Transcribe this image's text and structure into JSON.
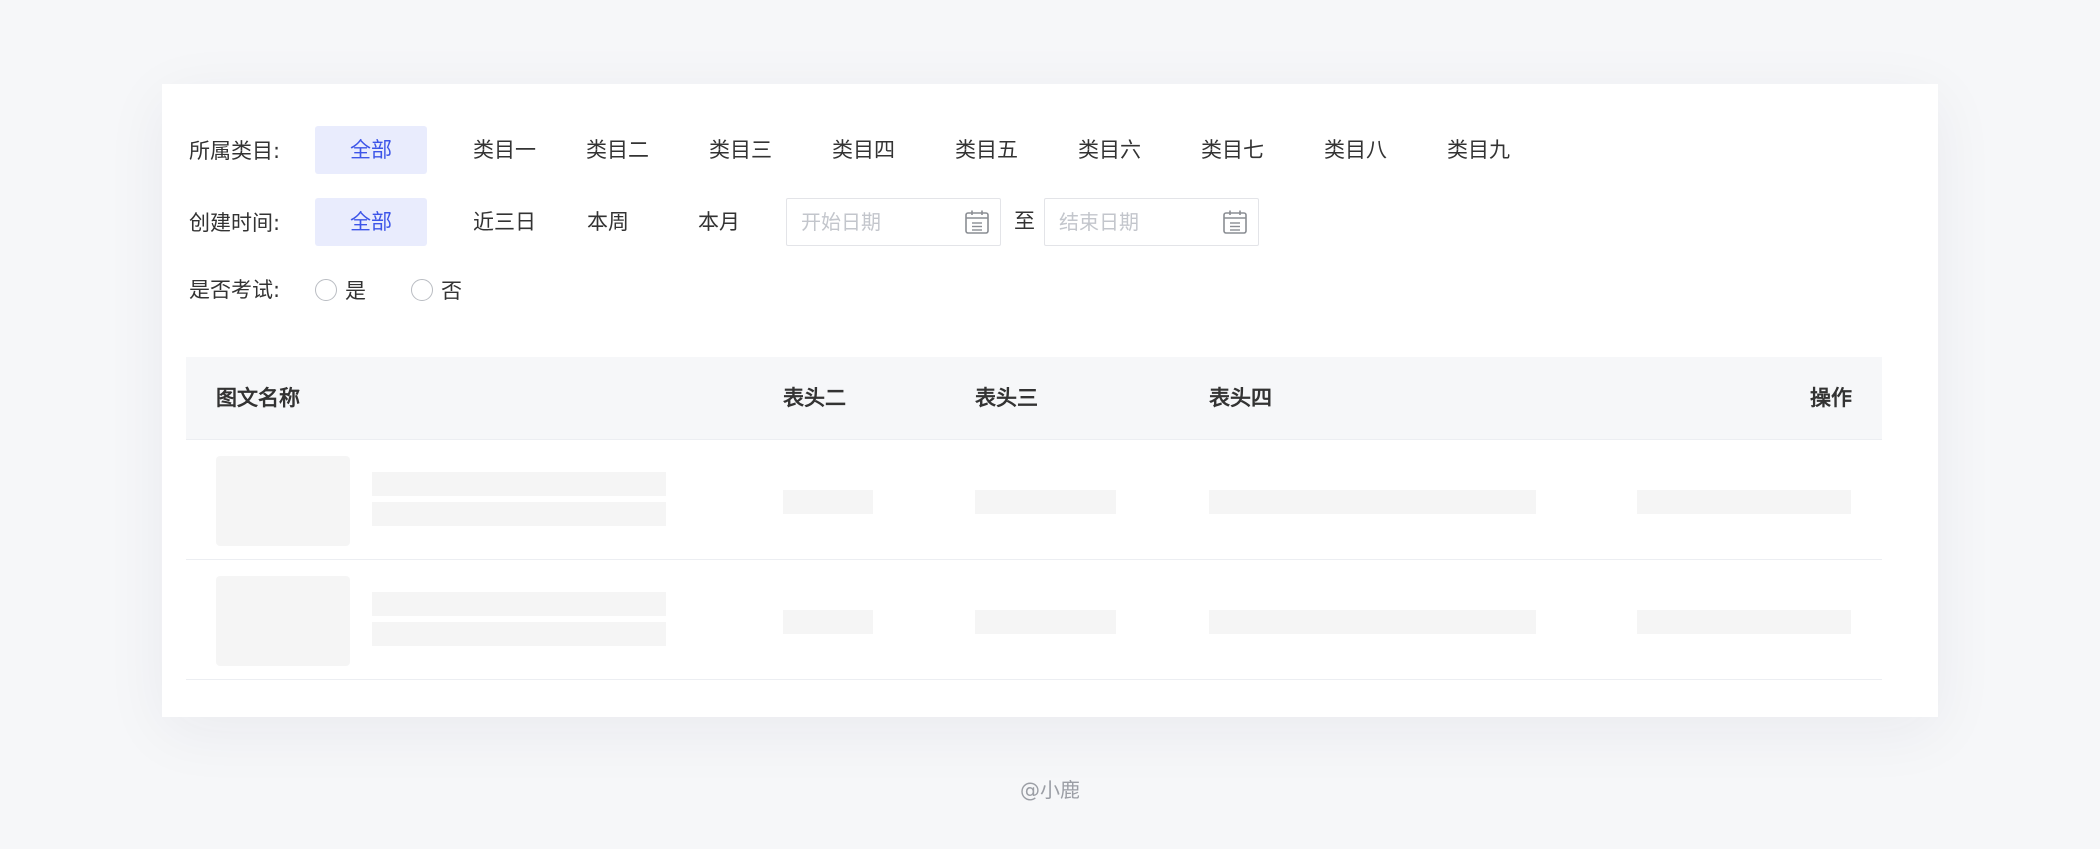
{
  "filters": {
    "category": {
      "label": "所属类目:",
      "options": [
        "全部",
        "类目一",
        "类目二",
        "类目三",
        "类目四",
        "类目五",
        "类目六",
        "类目七",
        "类目八",
        "类目九"
      ],
      "selected": "全部"
    },
    "created_time": {
      "label": "创建时间:",
      "options": [
        "全部",
        "近三日",
        "本周",
        "本月"
      ],
      "selected": "全部",
      "start_placeholder": "开始日期",
      "end_placeholder": "结束日期",
      "range_separator": "至"
    },
    "is_exam": {
      "label": "是否考试:",
      "options": [
        "是",
        "否"
      ]
    }
  },
  "table": {
    "columns": [
      "图文名称",
      "表头二",
      "表头三",
      "表头四",
      "操作"
    ],
    "rows_state": "loading"
  },
  "footer": {
    "watermark": "@小鹿"
  },
  "colors": {
    "accent": "#3d55e8",
    "accent_bg": "#e9ecfd",
    "page_bg": "#f6f7f9",
    "skeleton": "#f5f5f5"
  }
}
